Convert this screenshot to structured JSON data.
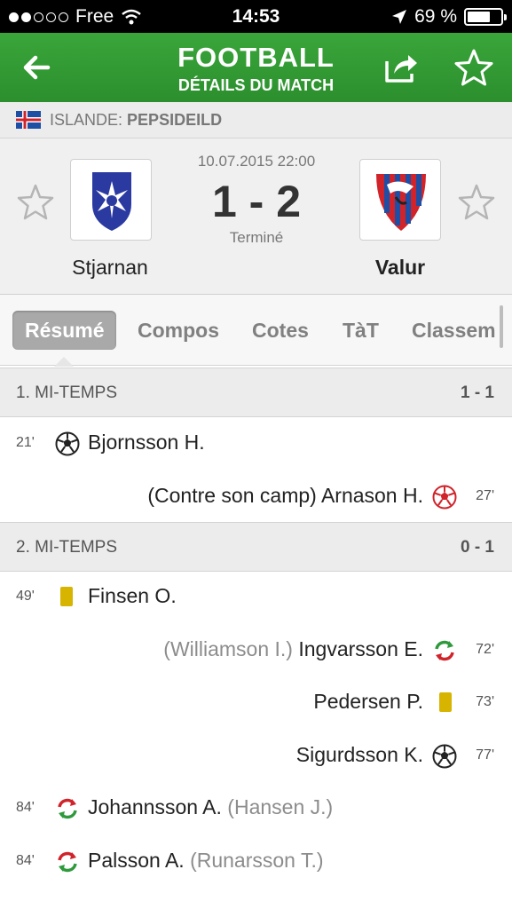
{
  "status_bar": {
    "carrier": "Free",
    "time": "14:53",
    "battery": "69 %",
    "battery_level": 0.69
  },
  "header": {
    "title": "FOOTBALL",
    "subtitle": "DÉTAILS DU MATCH",
    "back_icon": "arrow-left-icon",
    "share_icon": "share-icon",
    "favorite_icon": "star-icon"
  },
  "league": {
    "country": "ISLANDE:",
    "name": "PEPSIDEILD",
    "flag_icon": "iceland-flag-icon"
  },
  "match": {
    "datetime": "10.07.2015 22:00",
    "score": "1 - 2",
    "status": "Terminé",
    "home": {
      "name": "Stjarnan"
    },
    "away": {
      "name": "Valur"
    }
  },
  "tabs": [
    "Résumé",
    "Compos",
    "Cotes",
    "TàT",
    "Classem"
  ],
  "sections": [
    {
      "label": "1. MI-TEMPS",
      "score": "1 - 1",
      "events": [
        {
          "minute": "21'",
          "side": "home",
          "type": "goal",
          "player": "Bjornsson H.",
          "extra": ""
        },
        {
          "minute": "27'",
          "side": "away",
          "type": "own-goal",
          "player": "Arnason H.",
          "extra": "(Contre son camp)"
        }
      ]
    },
    {
      "label": "2. MI-TEMPS",
      "score": "0 - 1",
      "events": [
        {
          "minute": "49'",
          "side": "home",
          "type": "yellow-card",
          "player": "Finsen O.",
          "extra": ""
        },
        {
          "minute": "72'",
          "side": "away",
          "type": "substitution",
          "player": "Ingvarsson E.",
          "extra": "(Williamson I.)"
        },
        {
          "minute": "73'",
          "side": "away",
          "type": "yellow-card",
          "player": "Pedersen P.",
          "extra": ""
        },
        {
          "minute": "77'",
          "side": "away",
          "type": "goal",
          "player": "Sigurdsson K.",
          "extra": ""
        },
        {
          "minute": "84'",
          "side": "home",
          "type": "substitution",
          "player": "Johannsson A.",
          "extra": "(Hansen J.)"
        },
        {
          "minute": "84'",
          "side": "home",
          "type": "substitution",
          "player": "Palsson A.",
          "extra": "(Runarsson T.)"
        }
      ]
    }
  ],
  "colors": {
    "header_green": "#2b8f2d",
    "yellow_card": "#d6b400",
    "own_goal_red": "#d0232a",
    "sub_green": "#2f9a3c",
    "sub_red": "#d0232a"
  }
}
